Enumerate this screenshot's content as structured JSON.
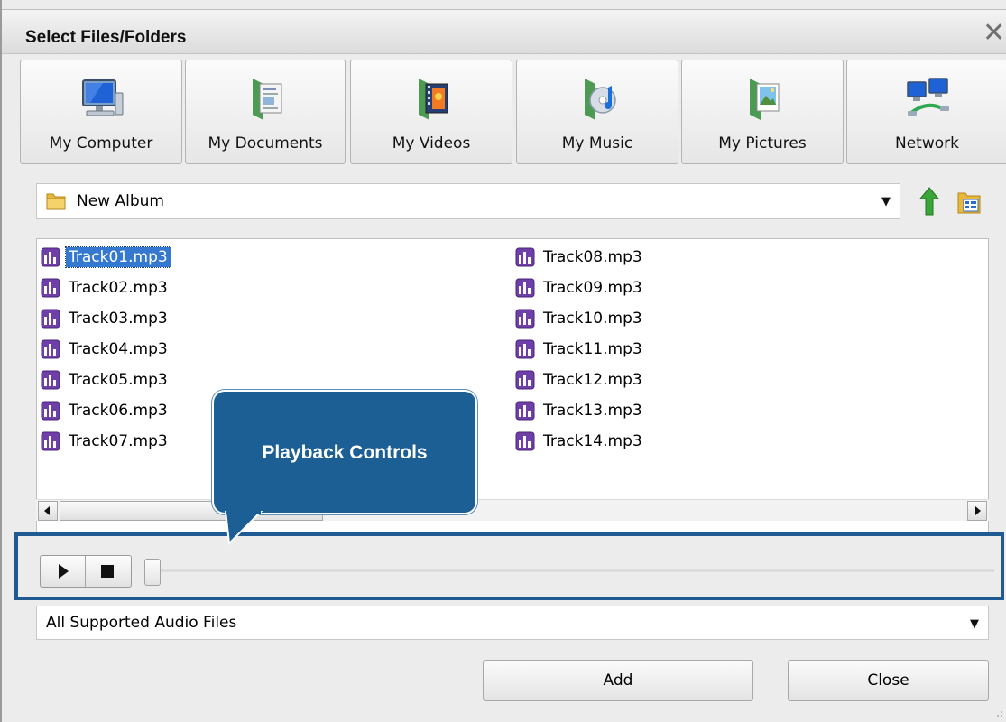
{
  "window": {
    "title": "Select Files/Folders",
    "close_glyph": "✕"
  },
  "places": [
    {
      "label": "My Computer",
      "icon": "computer-icon"
    },
    {
      "label": "My Documents",
      "icon": "documents-icon"
    },
    {
      "label": "My Videos",
      "icon": "videos-icon"
    },
    {
      "label": "My Music",
      "icon": "music-icon"
    },
    {
      "label": "My Pictures",
      "icon": "pictures-icon"
    },
    {
      "label": "Network",
      "icon": "network-icon"
    }
  ],
  "path": {
    "current": "New Album",
    "icon": "folder-icon"
  },
  "toolbar": {
    "up_icon": "up-arrow-icon",
    "view_icon": "view-mode-icon"
  },
  "files": {
    "selected": "Track01.mp3",
    "column1": [
      "Track01.mp3",
      "Track02.mp3",
      "Track03.mp3",
      "Track04.mp3",
      "Track05.mp3",
      "Track06.mp3",
      "Track07.mp3"
    ],
    "column2": [
      "Track08.mp3",
      "Track09.mp3",
      "Track10.mp3",
      "Track11.mp3",
      "Track12.mp3",
      "Track13.mp3",
      "Track14.mp3"
    ],
    "icon": "audio-file-icon"
  },
  "playback": {
    "play_icon": "play-icon",
    "stop_icon": "stop-icon",
    "position": 0
  },
  "callout": {
    "text": "Playback Controls"
  },
  "filter": {
    "value": "All Supported Audio Files"
  },
  "buttons": {
    "add": "Add",
    "close": "Close"
  },
  "colors": {
    "selection": "#3578d0",
    "callout": "#1c5f95",
    "highlight_border": "#1f5a93"
  }
}
